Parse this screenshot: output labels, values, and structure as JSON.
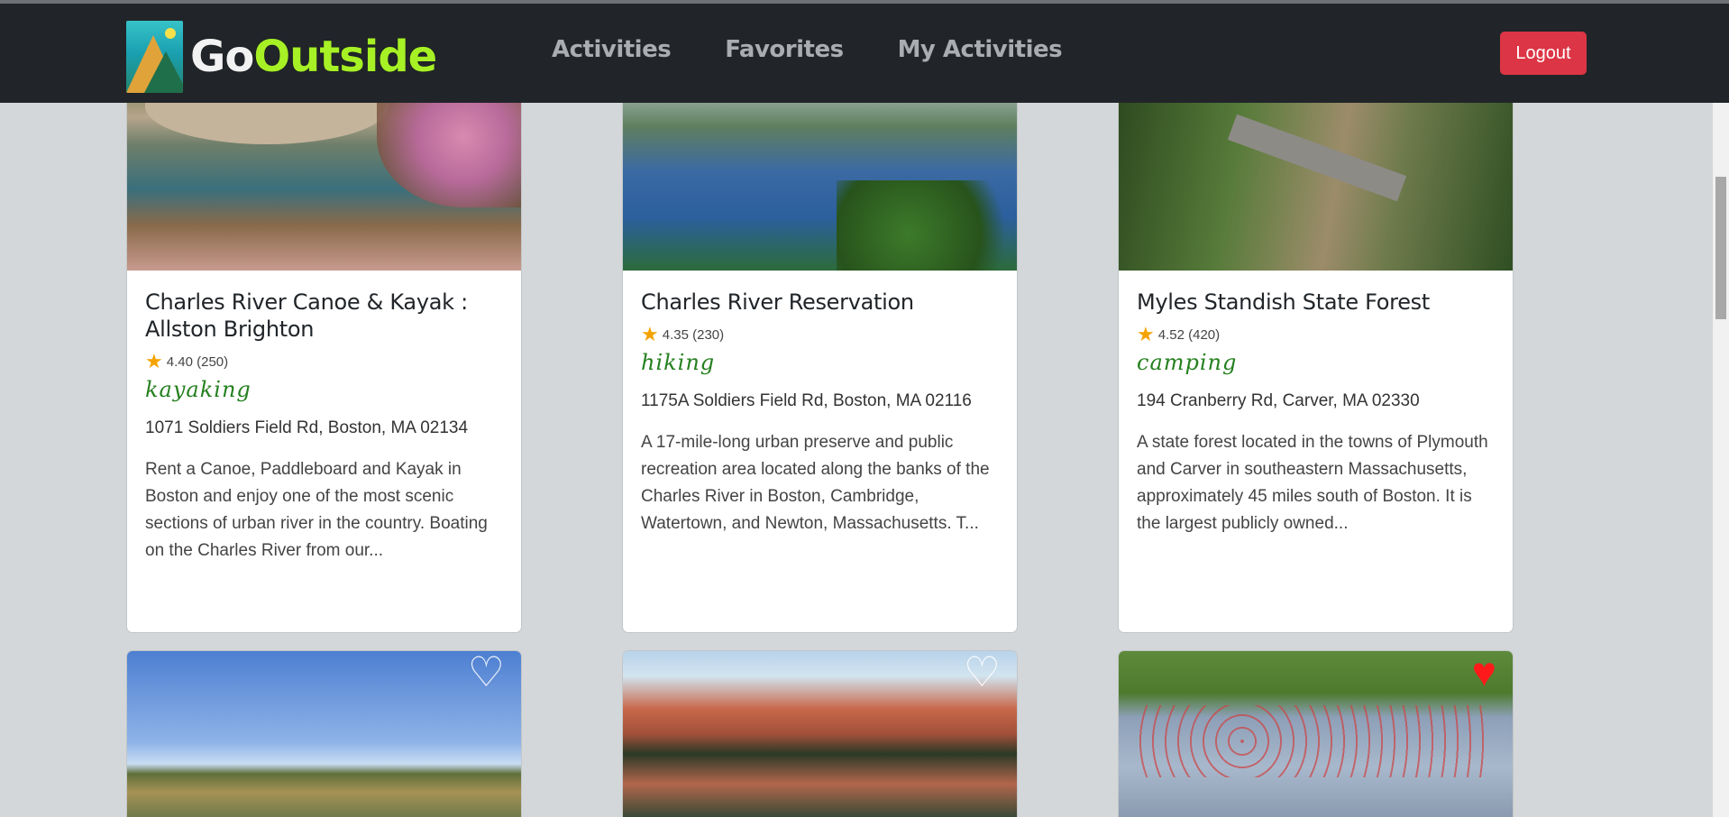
{
  "app": {
    "logo_part1": "Go",
    "logo_part2": "Outside"
  },
  "nav": {
    "items": [
      {
        "label": "Activities"
      },
      {
        "label": "Favorites"
      },
      {
        "label": "My Activities"
      }
    ],
    "logout_label": "Logout"
  },
  "colors": {
    "navbar": "#212529",
    "logout": "#dc3545",
    "activity_type": "#25801f",
    "star": "#f4a300",
    "heart_favorited": "#ff1a1a"
  },
  "cards": [
    {
      "title": "Charles River Canoe & Kayak : Allston Brighton",
      "rating": "4.40",
      "reviews": "(250)",
      "activity": "kayaking",
      "address": "1071 Soldiers Field Rd, Boston, MA 02134",
      "description": "Rent a Canoe, Paddleboard and Kayak in Boston and enjoy one of the most scenic sections of urban river in the country. Boating on the Charles River from our..."
    },
    {
      "title": "Charles River Reservation",
      "rating": "4.35",
      "reviews": "(230)",
      "activity": "hiking",
      "address": "1175A Soldiers Field Rd, Boston, MA 02116",
      "description": "A 17-mile-long urban preserve and public recreation area located along the banks of the Charles River in Boston, Cambridge, Watertown, and Newton, Massachusetts. T..."
    },
    {
      "title": "Myles Standish State Forest",
      "rating": "4.52",
      "reviews": "(420)",
      "activity": "camping",
      "address": "194 Cranberry Rd, Carver, MA 02330",
      "description": "A state forest located in the towns of Plymouth and Carver in southeastern Massachusetts, approximately 45 miles south of Boston. It is the largest publicly owned..."
    }
  ],
  "second_row": [
    {
      "favorited": false,
      "icon": "heart-outline-icon"
    },
    {
      "favorited": false,
      "icon": "heart-outline-icon"
    },
    {
      "favorited": true,
      "icon": "heart-filled-icon"
    }
  ]
}
